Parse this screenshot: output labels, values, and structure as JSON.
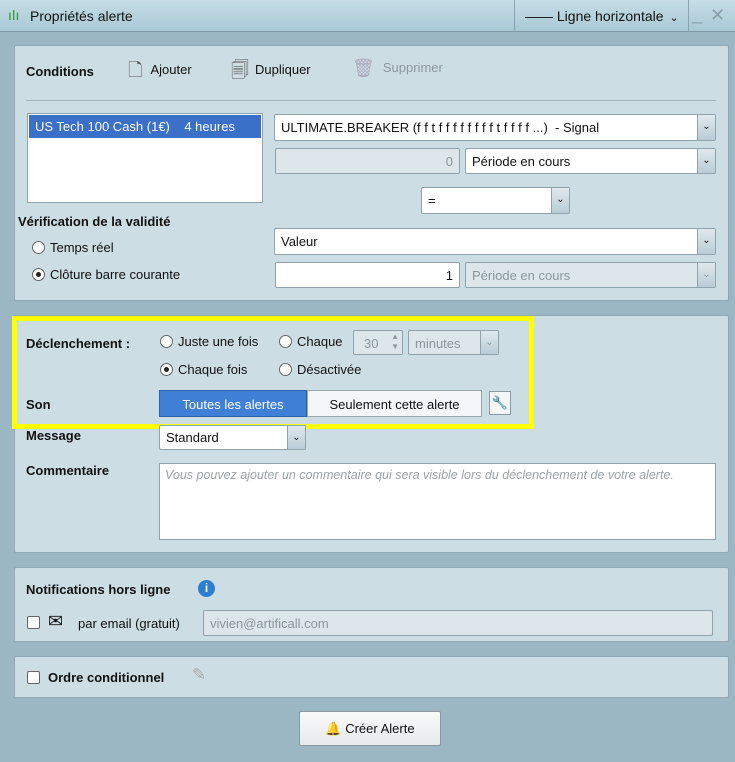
{
  "window": {
    "title": "Propriétés alerte",
    "drawing_type": "Ligne horizontale"
  },
  "conditions": {
    "label": "Conditions",
    "add": "Ajouter",
    "duplicate": "Dupliquer",
    "delete": "Supprimer",
    "list": [
      "US Tech 100 Cash (1€)    4 heures"
    ],
    "indicator": "ULTIMATE.BREAKER (f f t f f f f f f f f t f f f f ...)  - Signal",
    "offset_value": "0",
    "period1": "Période en cours",
    "operator": "=",
    "compare_type": "Valeur",
    "compare_value": "1",
    "period2": "Période en cours"
  },
  "validity": {
    "label": "Vérification de la validité",
    "options": [
      "Temps réel",
      "Clôture barre courante"
    ],
    "selected": 1
  },
  "trigger": {
    "label": "Déclenchement :",
    "once": "Juste une fois",
    "every": "Chaque",
    "every_value": "30",
    "every_unit": "minutes",
    "each_time": "Chaque fois",
    "disabled": "Désactivée",
    "selected": "each_time"
  },
  "sound": {
    "label": "Son",
    "all": "Toutes les alertes",
    "only": "Seulement cette alerte",
    "active": "all"
  },
  "message": {
    "label": "Message",
    "value": "Standard"
  },
  "comment": {
    "label": "Commentaire",
    "placeholder": "Vous pouvez ajouter un commentaire qui sera visible lors du déclenchement de votre alerte."
  },
  "offline": {
    "label": "Notifications hors ligne",
    "email_label": "par email (gratuit)",
    "email": "vivien@artificall.com"
  },
  "conditional_order": {
    "label": "Ordre conditionnel"
  },
  "create_button": "Créer Alerte",
  "colors": {
    "highlight": "#ffff00",
    "accent": "#3f7fd6"
  }
}
